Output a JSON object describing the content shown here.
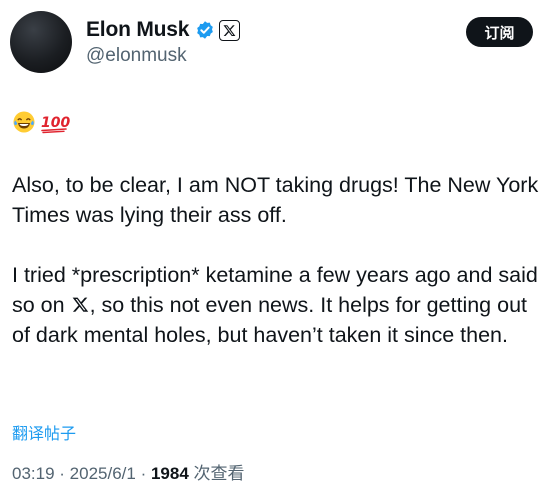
{
  "author": {
    "display_name": "Elon Musk",
    "handle": "@elonmusk",
    "verified": true
  },
  "header": {
    "subscribe_label": "订阅"
  },
  "tweet": {
    "emojis": [
      "😂",
      "💯"
    ],
    "paragraph1": "Also, to be clear, I am NOT taking drugs! The New York Times was lying their ass off.",
    "paragraph2_before_x": "I tried *prescription* ketamine a few years ago and said so on ",
    "paragraph2_after_x": ", so this not even news. It helps for getting out of dark mental holes, but haven’t taken it since then.",
    "translate_label": "翻译帖子"
  },
  "meta": {
    "time": "03:19",
    "sep1": " · ",
    "date": "2025/6/1",
    "sep2": " · ",
    "views_count": "1984",
    "views_label": " 次查看"
  },
  "colors": {
    "accent": "#1d9bf0",
    "text": "#0f1419",
    "muted": "#536471",
    "button_bg": "#0f1419"
  },
  "icons": {
    "verified": "verified-badge-icon",
    "x_logo": "x-logo-icon",
    "laugh": "tears-of-joy-icon",
    "hundred": "hundred-points-icon"
  }
}
